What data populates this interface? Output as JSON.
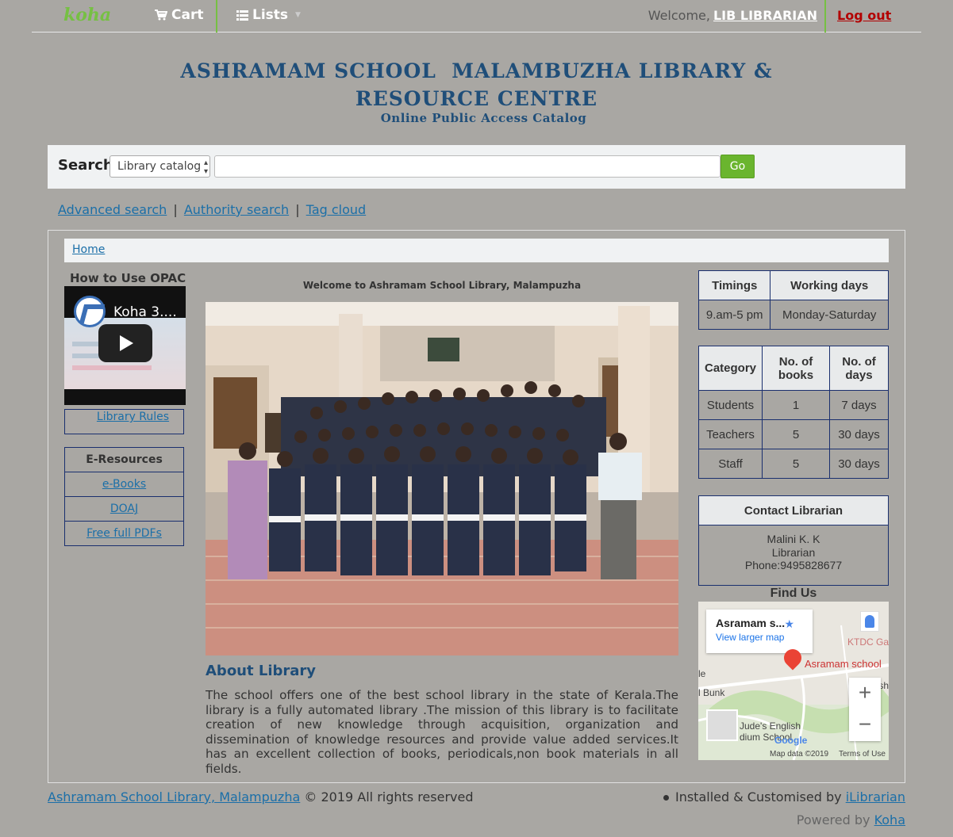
{
  "nav": {
    "logo": "koha",
    "cart": "Cart",
    "lists": "Lists",
    "welcome": "Welcome,",
    "user": "LIB LIBRARIAN",
    "logout": "Log out"
  },
  "header": {
    "title_line1": "ASHRAMAM SCHOOL  MALAMBUZHA LIBRARY &",
    "title_line2": "RESOURCE CENTRE",
    "subtitle": "Online Public Access Catalog"
  },
  "search": {
    "label": "Search",
    "scope": "Library catalog",
    "query": "",
    "go": "Go",
    "links": [
      "Advanced search",
      "Authority search",
      "Tag cloud"
    ]
  },
  "breadcrumb": "Home",
  "left": {
    "howto_title": "How to Use OPAC",
    "video_title": "Koha 3....",
    "library_rules": "Library Rules",
    "eresources_title": "E-Resources",
    "eresources": [
      "e-Books",
      "DOAJ",
      "Free full PDFs"
    ]
  },
  "center": {
    "welcome": "Welcome to Ashramam School Library, Malampuzha",
    "about_title": "About Library",
    "about_text": "The school offers one of the best school library in the state of Kerala.The library is a fully automated library .The mission of this library is to facilitate creation of new knowledge through acquisition, organization and dissemination of knowledge resources and provide value added services.It has an excellent collection of books, periodicals,non book materials in all fields."
  },
  "right": {
    "timings": {
      "headers": [
        "Timings",
        "Working days"
      ],
      "row": [
        "9.am-5 pm",
        "Monday-Saturday"
      ]
    },
    "categories": {
      "headers": [
        "Category",
        "No. of books",
        "No. of days"
      ],
      "rows": [
        [
          "Students",
          "1",
          "7 days"
        ],
        [
          "Teachers",
          "5",
          "30 days"
        ],
        [
          "Staff",
          "5",
          "30 days"
        ]
      ]
    },
    "contact": {
      "title": "Contact Librarian",
      "name": "Malini K. K",
      "role": "Librarian",
      "phone": "Phone:9495828677"
    },
    "findus": "Find Us",
    "map": {
      "place": "Asramam s...",
      "larger": "View larger map",
      "label_ktdc": "KTDC Ga",
      "label_school": "Asramam school",
      "label_bunk": "l Bunk",
      "label_le": "le",
      "label_jude": "Jude's English",
      "label_stadium": "dium School",
      "label_sh": "sh",
      "google": "Google",
      "mapdata": "Map data ©2019",
      "terms": "Terms of Use"
    }
  },
  "footer": {
    "library": "Ashramam School Library, Malampuzha",
    "rights": "© 2019 All rights reserved",
    "installed": "Installed & Customised by",
    "ilibrarian": "iLibrarian",
    "powered": "Powered by",
    "koha": "Koha"
  }
}
